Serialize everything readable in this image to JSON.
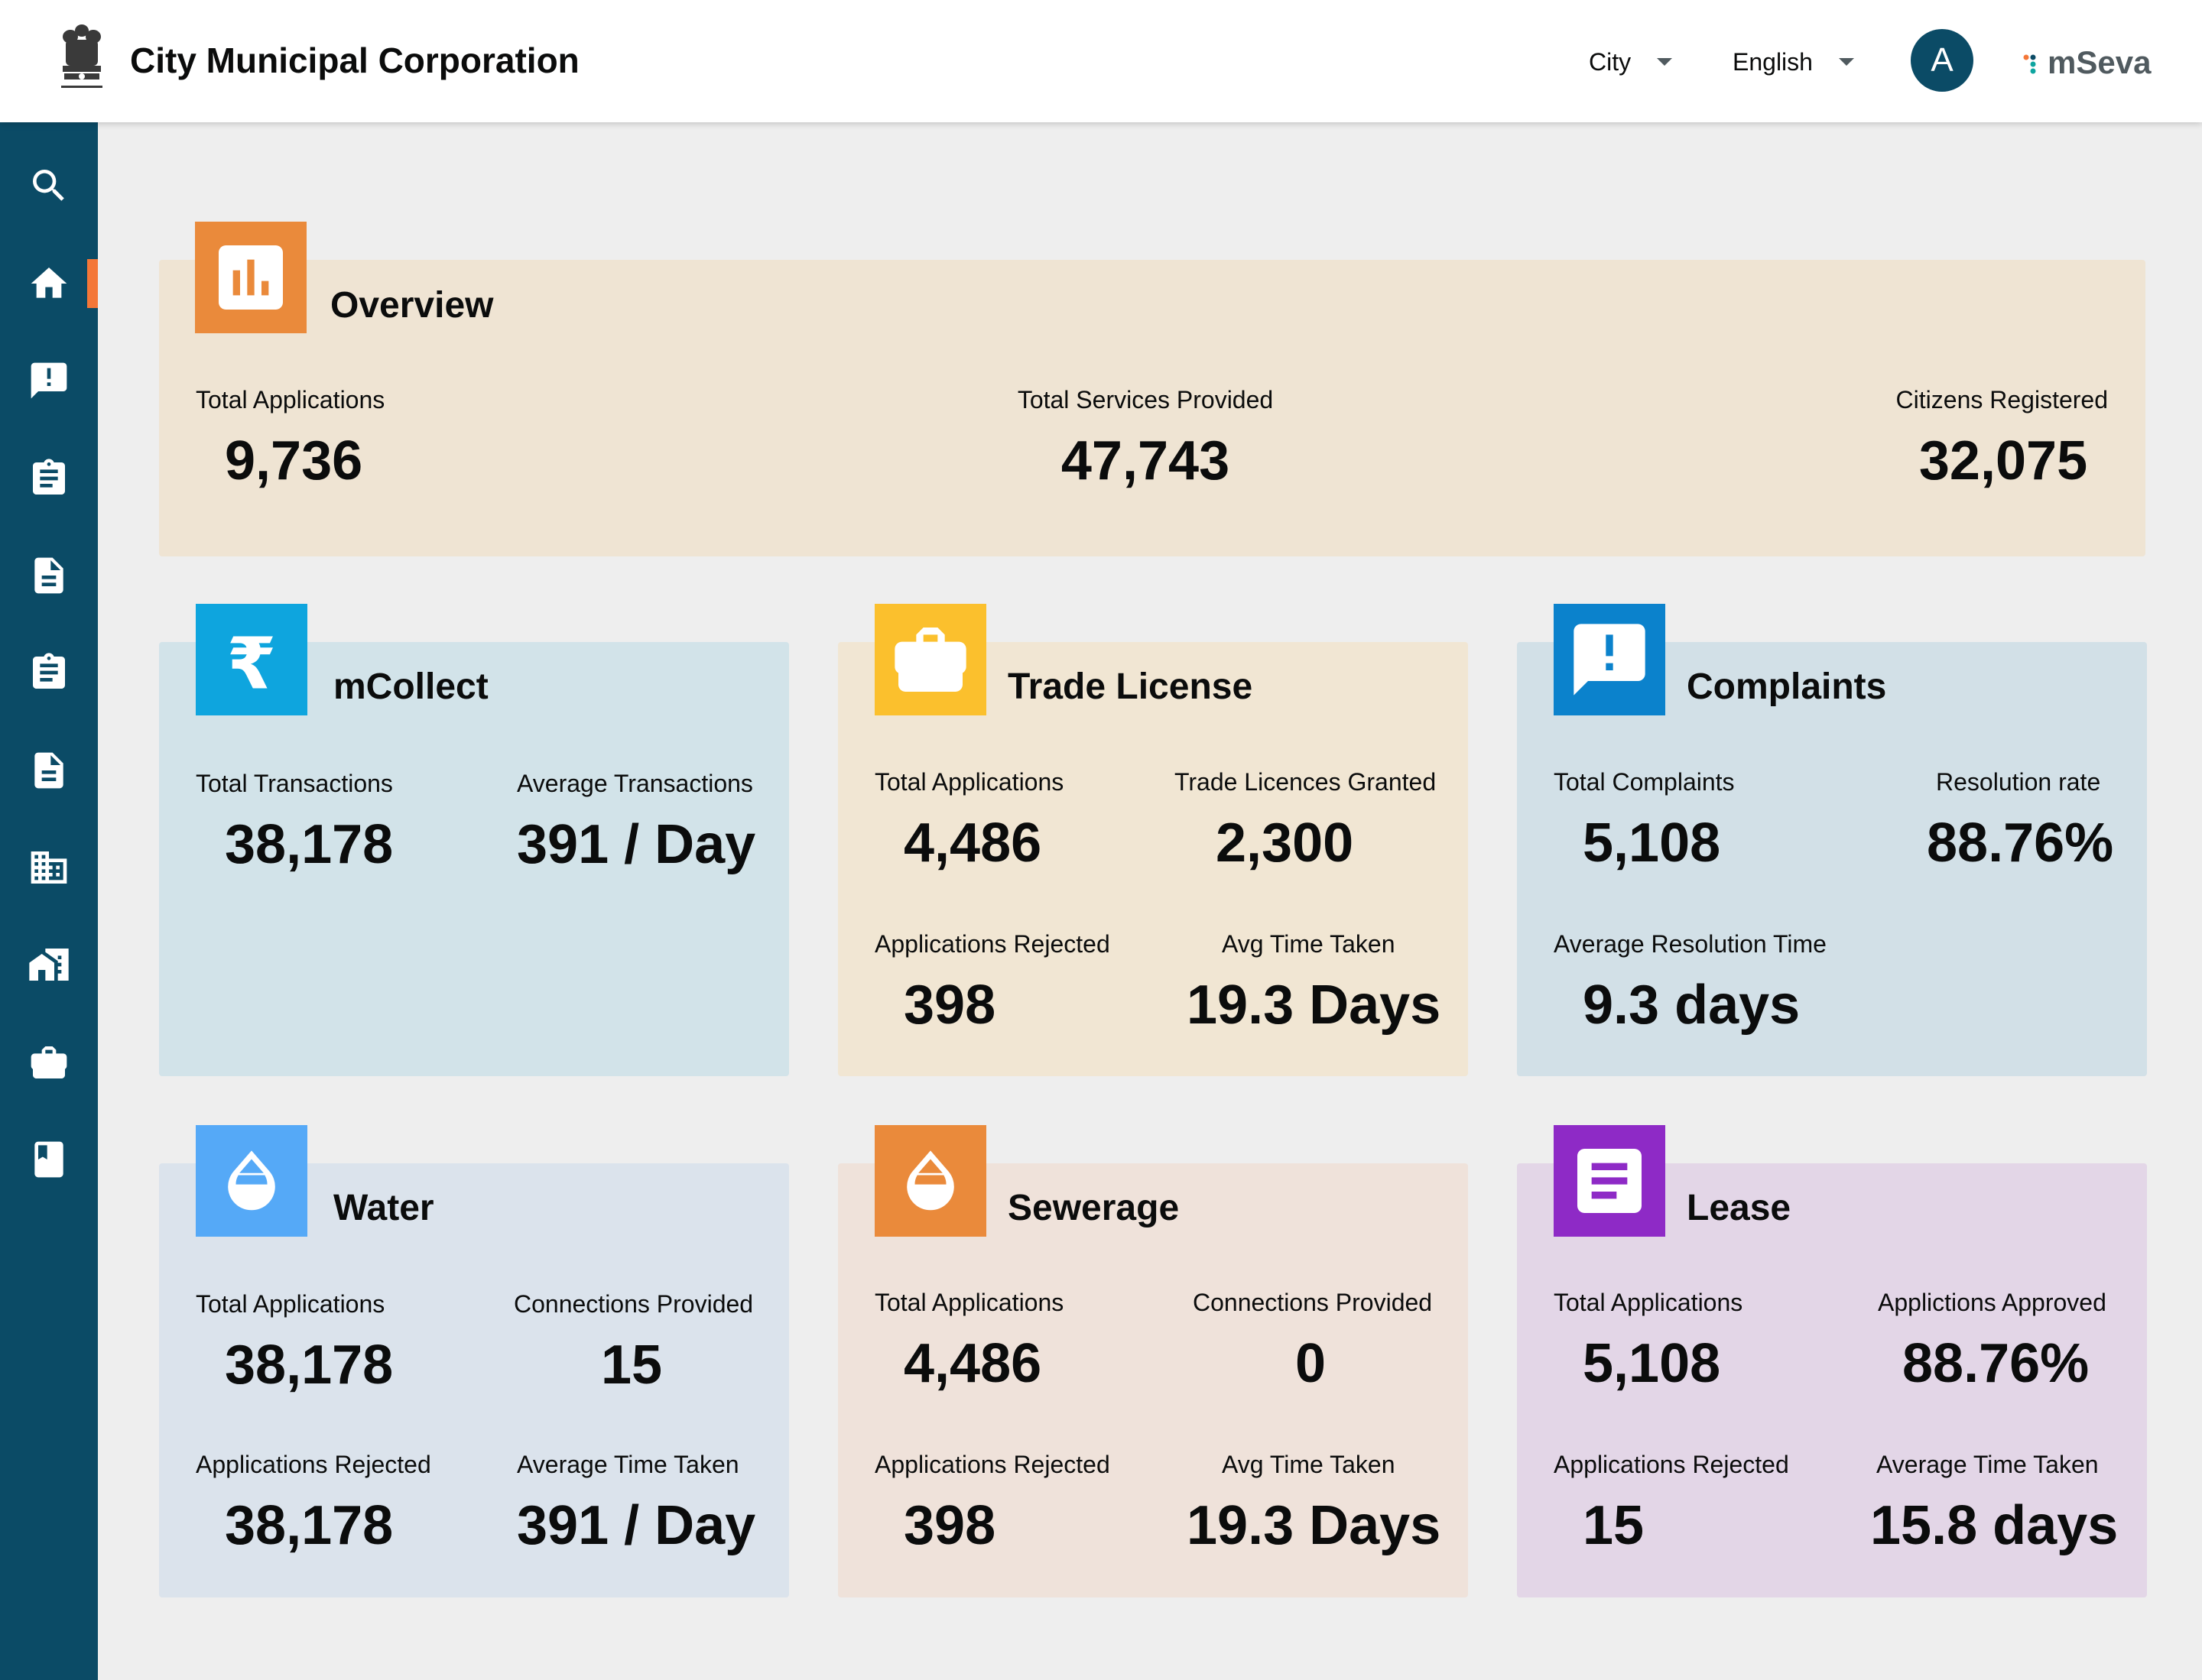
{
  "header": {
    "title": "City Municipal Corporation",
    "city_dropdown": "City",
    "language_dropdown": "English",
    "avatar_initial": "A",
    "brand": "mSeva",
    "emblem_icon": "state-emblem-icon"
  },
  "sidebar": {
    "items": [
      {
        "icon": "search-icon"
      },
      {
        "icon": "home-icon",
        "active": true
      },
      {
        "icon": "complaint-icon"
      },
      {
        "icon": "clipboard-icon"
      },
      {
        "icon": "document-icon"
      },
      {
        "icon": "clipboard-icon"
      },
      {
        "icon": "document-icon"
      },
      {
        "icon": "building-icon"
      },
      {
        "icon": "property-icon"
      },
      {
        "icon": "briefcase-icon"
      },
      {
        "icon": "book-icon"
      }
    ],
    "active_indicator_color": "#f47738"
  },
  "overview": {
    "title": "Overview",
    "icon": "bar-chart-icon",
    "metrics": [
      {
        "label": "Total Applications",
        "value": "9,736"
      },
      {
        "label": "Total Services Provided",
        "value": "47,743"
      },
      {
        "label": "Citizens Registered",
        "value": "32,075"
      }
    ]
  },
  "cards": {
    "mcollect": {
      "title": "mCollect",
      "icon": "rupee-icon",
      "metrics": [
        {
          "label": "Total Transactions",
          "value": "38,178"
        },
        {
          "label": "Average Transactions",
          "value": "391 / Day"
        }
      ]
    },
    "trade_license": {
      "title": "Trade License",
      "icon": "briefcase-icon",
      "metrics": [
        {
          "label": "Total Applications",
          "value": "4,486"
        },
        {
          "label": "Trade Licences Granted",
          "value": "2,300"
        },
        {
          "label": "Applications Rejected",
          "value": "398"
        },
        {
          "label": "Avg Time Taken",
          "value": "19.3 Days"
        }
      ]
    },
    "complaints": {
      "title": "Complaints",
      "icon": "complaint-icon",
      "metrics": [
        {
          "label": "Total Complaints",
          "value": "5,108"
        },
        {
          "label": "Resolution rate",
          "value": "88.76%"
        },
        {
          "label": "Average Resolution Time",
          "value": "9.3 days"
        }
      ]
    },
    "water": {
      "title": "Water",
      "icon": "water-drop-icon",
      "metrics": [
        {
          "label": "Total Applications",
          "value": "38,178"
        },
        {
          "label": "Connections Provided",
          "value": "15"
        },
        {
          "label": "Applications Rejected",
          "value": "38,178"
        },
        {
          "label": "Average Time Taken",
          "value": "391 / Day"
        }
      ]
    },
    "sewerage": {
      "title": "Sewerage",
      "icon": "water-drop-icon",
      "metrics": [
        {
          "label": "Total Applications",
          "value": "4,486"
        },
        {
          "label": "Connections Provided",
          "value": "0"
        },
        {
          "label": "Applications Rejected",
          "value": "398"
        },
        {
          "label": "Avg Time Taken",
          "value": "19.3 Days"
        }
      ]
    },
    "lease": {
      "title": "Lease",
      "icon": "lease-document-icon",
      "metrics": [
        {
          "label": "Total Applications",
          "value": "5,108"
        },
        {
          "label": "Applictions Approved",
          "value": "88.76%"
        },
        {
          "label": "Applications Rejected",
          "value": "15"
        },
        {
          "label": "Average Time Taken",
          "value": "15.8 days"
        }
      ]
    }
  },
  "colors": {
    "sidebar": "#0b4b66",
    "overview_bg": "#efe4d3",
    "overview_icon": "#ea8a3b",
    "mcollect_bg": "#d2e3e9",
    "mcollect_icon": "#0ea5de",
    "trade_bg": "#f1e6d3",
    "trade_icon": "#fbc02d",
    "complaints_bg": "#d2e0e7",
    "complaints_icon": "#0b82cc",
    "water_bg": "#dbe3ec",
    "water_icon": "#55a9f7",
    "sewerage_bg": "#efe2da",
    "sewerage_icon": "#ea8a3b",
    "lease_bg": "#e3d6e7",
    "lease_icon": "#8e2ac6"
  }
}
